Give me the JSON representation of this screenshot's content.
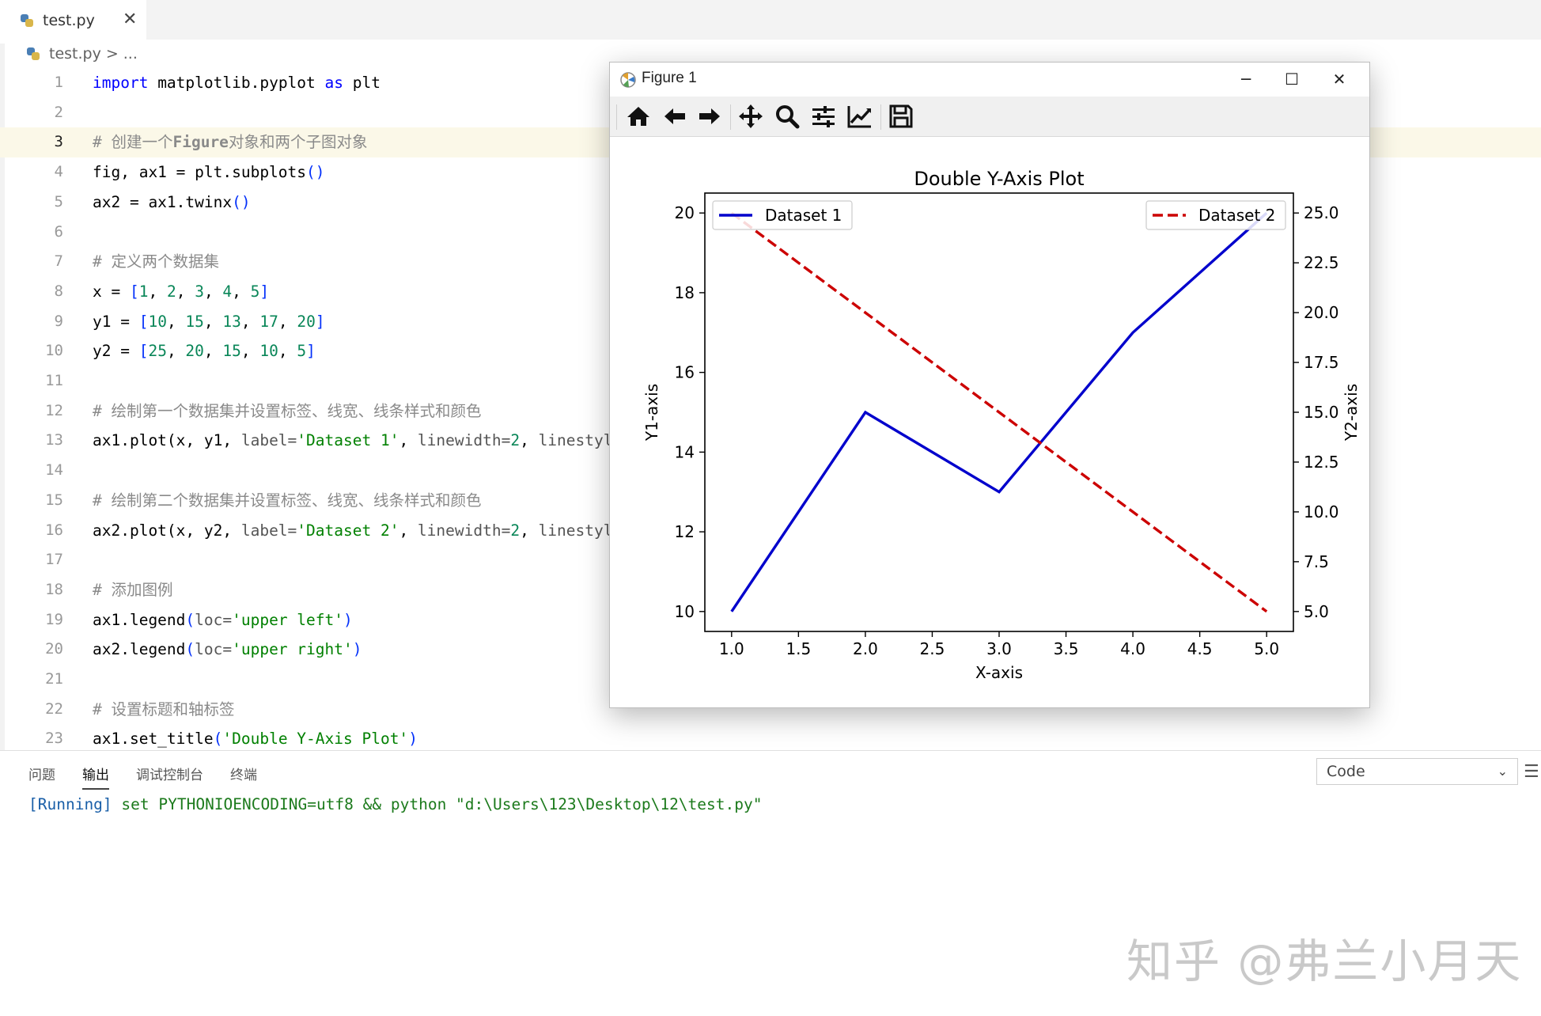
{
  "tab": {
    "label": "test.py",
    "close": "✕"
  },
  "breadcrumb": {
    "file": "test.py",
    "sep": ">",
    "more": "..."
  },
  "editor": {
    "lines": [
      {
        "n": "1"
      },
      {
        "n": "2"
      },
      {
        "n": "3"
      },
      {
        "n": "4"
      },
      {
        "n": "5"
      },
      {
        "n": "6"
      },
      {
        "n": "7"
      },
      {
        "n": "8"
      },
      {
        "n": "9"
      },
      {
        "n": "10"
      },
      {
        "n": "11"
      },
      {
        "n": "12"
      },
      {
        "n": "13"
      },
      {
        "n": "14"
      },
      {
        "n": "15"
      },
      {
        "n": "16"
      },
      {
        "n": "17"
      },
      {
        "n": "18"
      },
      {
        "n": "19"
      },
      {
        "n": "20"
      },
      {
        "n": "21"
      },
      {
        "n": "22"
      },
      {
        "n": "23"
      }
    ],
    "code": {
      "l1_kw": "import",
      "l1_mid": " matplotlib.pyplot ",
      "l1_kw2": "as",
      "l1_end": " plt",
      "l3": "# 创建一个",
      "l3_b": "Figure",
      "l3_end": "对象和两个子图对象",
      "l4": "fig, ax1 = plt.subplots",
      "l4_p": "()",
      "l5": "ax2 = ax1.twinx",
      "l5_p": "()",
      "l7": "# 定义两个数据集",
      "l8_a": "x = ",
      "l8_b": "[",
      "l8_n": [
        "1",
        "2",
        "3",
        "4",
        "5"
      ],
      "l8_c": "]",
      "l9_a": "y1 = ",
      "l9_n": [
        "10",
        "15",
        "13",
        "17",
        "20"
      ],
      "l10_a": "y2 = ",
      "l10_n": [
        "25",
        "20",
        "15",
        "10",
        "5"
      ],
      "l12": "# 绘制第一个数据集并设置标签、线宽、线条样式和颜色",
      "l13_a": "ax1.plot",
      "l13_b": "(x, y1, ",
      "l13_p": "label=",
      "l13_s": "'Dataset 1'",
      "l13_c": ", ",
      "l13_p2": "linewidth=",
      "l13_n": "2",
      "l13_d": ", ",
      "l13_p3": "linestyl",
      "l15": "# 绘制第二个数据集并设置标签、线宽、线条样式和颜色",
      "l16_a": "ax2.plot",
      "l16_b": "(x, y2, ",
      "l16_p": "label=",
      "l16_s": "'Dataset 2'",
      "l16_c": ", ",
      "l16_p2": "linewidth=",
      "l16_n": "2",
      "l16_d": ", ",
      "l16_p3": "linestyl",
      "l18": "# 添加图例",
      "l19_a": "ax1.legend",
      "l19_b": "(",
      "l19_p": "loc=",
      "l19_s": "'upper left'",
      "l19_c": ")",
      "l20_a": "ax2.legend",
      "l20_b": "(",
      "l20_p": "loc=",
      "l20_s": "'upper right'",
      "l20_c": ")",
      "l22": "# 设置标题和轴标签",
      "l23_a": "ax1.set_title",
      "l23_b": "(",
      "l23_s": "'Double Y-Axis Plot'",
      "l23_c": ")"
    }
  },
  "panel": {
    "tabs": [
      "问题",
      "输出",
      "调试控制台",
      "终端"
    ],
    "active_tab": "输出",
    "select_value": "Code",
    "menu_icon": "☰",
    "output_tag": "[Running]",
    "output_cmd": " set PYTHONIOENCODING=utf8 && python \"d:\\Users\\123\\Desktop\\12\\test.py\""
  },
  "watermark": "知乎 @弗兰小月天",
  "figure_window": {
    "title": "Figure 1",
    "buttons": {
      "minimize": "─",
      "maximize": "☐",
      "close": "✕"
    },
    "toolbar": [
      "home-icon",
      "back-arrow-icon",
      "forward-arrow-icon",
      "pan-icon",
      "zoom-icon",
      "configure-subplots-icon",
      "edit-axis-icon",
      "save-icon"
    ]
  },
  "chart_data": {
    "type": "line",
    "title": "Double Y-Axis Plot",
    "xlabel": "X-axis",
    "ylabel": "Y1-axis",
    "y2label": "Y2-axis",
    "x": [
      1,
      2,
      3,
      4,
      5
    ],
    "xlim": [
      0.8,
      5.2
    ],
    "ylim": [
      9.5,
      20.5
    ],
    "y2lim": [
      4.0,
      26.0
    ],
    "xticks": [
      "1.0",
      "1.5",
      "2.0",
      "2.5",
      "3.0",
      "3.5",
      "4.0",
      "4.5",
      "5.0"
    ],
    "yticks": [
      "10",
      "12",
      "14",
      "16",
      "18",
      "20"
    ],
    "y2ticks": [
      "5.0",
      "7.5",
      "10.0",
      "12.5",
      "15.0",
      "17.5",
      "20.0",
      "22.5",
      "25.0"
    ],
    "series": [
      {
        "name": "Dataset 1",
        "axis": "left",
        "values": [
          10,
          15,
          13,
          17,
          20
        ],
        "color": "#0000cc",
        "style": "solid"
      },
      {
        "name": "Dataset 2",
        "axis": "right",
        "values": [
          25,
          20,
          15,
          10,
          5
        ],
        "color": "#cc0000",
        "style": "dashed"
      }
    ],
    "legend_left": "upper left",
    "legend_right": "upper right",
    "grid": false
  }
}
